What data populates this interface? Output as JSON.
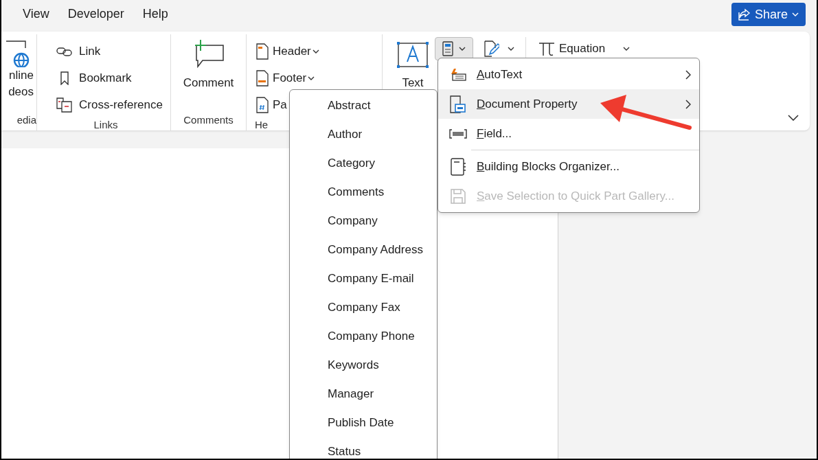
{
  "tabs": [
    {
      "label": "View",
      "selected": false
    },
    {
      "label": "Developer",
      "selected": false
    },
    {
      "label": "Help",
      "selected": false
    }
  ],
  "share_button": {
    "label": "Share"
  },
  "ribbon": {
    "groups": [
      {
        "kind": "media",
        "label": "edia",
        "lines": [
          "nline",
          "deos"
        ]
      },
      {
        "kind": "list",
        "label": "Links",
        "items": [
          {
            "label": "Link",
            "dropdown": false
          },
          {
            "label": "Bookmark",
            "dropdown": false
          },
          {
            "label": "Cross-reference",
            "dropdown": false
          }
        ]
      },
      {
        "kind": "large",
        "label": "Comments",
        "button": "Comment"
      },
      {
        "kind": "list",
        "label": "He",
        "items": [
          {
            "label": "Header",
            "dropdown": true
          },
          {
            "label": "Footer",
            "dropdown": true
          },
          {
            "label": "Pa",
            "dropdown": false
          }
        ]
      },
      {
        "kind": "text",
        "button": "Text",
        "quick_parts_pressed": true,
        "equation": "Equation"
      }
    ]
  },
  "menu": [
    {
      "label": "AutoText",
      "submenu": true,
      "highlighted": false,
      "disabled": false,
      "separator_before": false
    },
    {
      "label": "Document Property",
      "submenu": true,
      "highlighted": true,
      "disabled": false,
      "separator_before": false
    },
    {
      "label": "Field...",
      "submenu": false,
      "highlighted": false,
      "disabled": false,
      "separator_before": false
    },
    {
      "label": "Building Blocks Organizer...",
      "submenu": false,
      "highlighted": false,
      "disabled": false,
      "separator_before": true
    },
    {
      "label": "Save Selection to Quick Part Gallery...",
      "submenu": false,
      "highlighted": false,
      "disabled": true,
      "separator_before": false
    }
  ],
  "submenu": [
    "Abstract",
    "Author",
    "Category",
    "Comments",
    "Company",
    "Company Address",
    "Company E-mail",
    "Company Fax",
    "Company Phone",
    "Keywords",
    "Manager",
    "Publish Date",
    "Status"
  ]
}
